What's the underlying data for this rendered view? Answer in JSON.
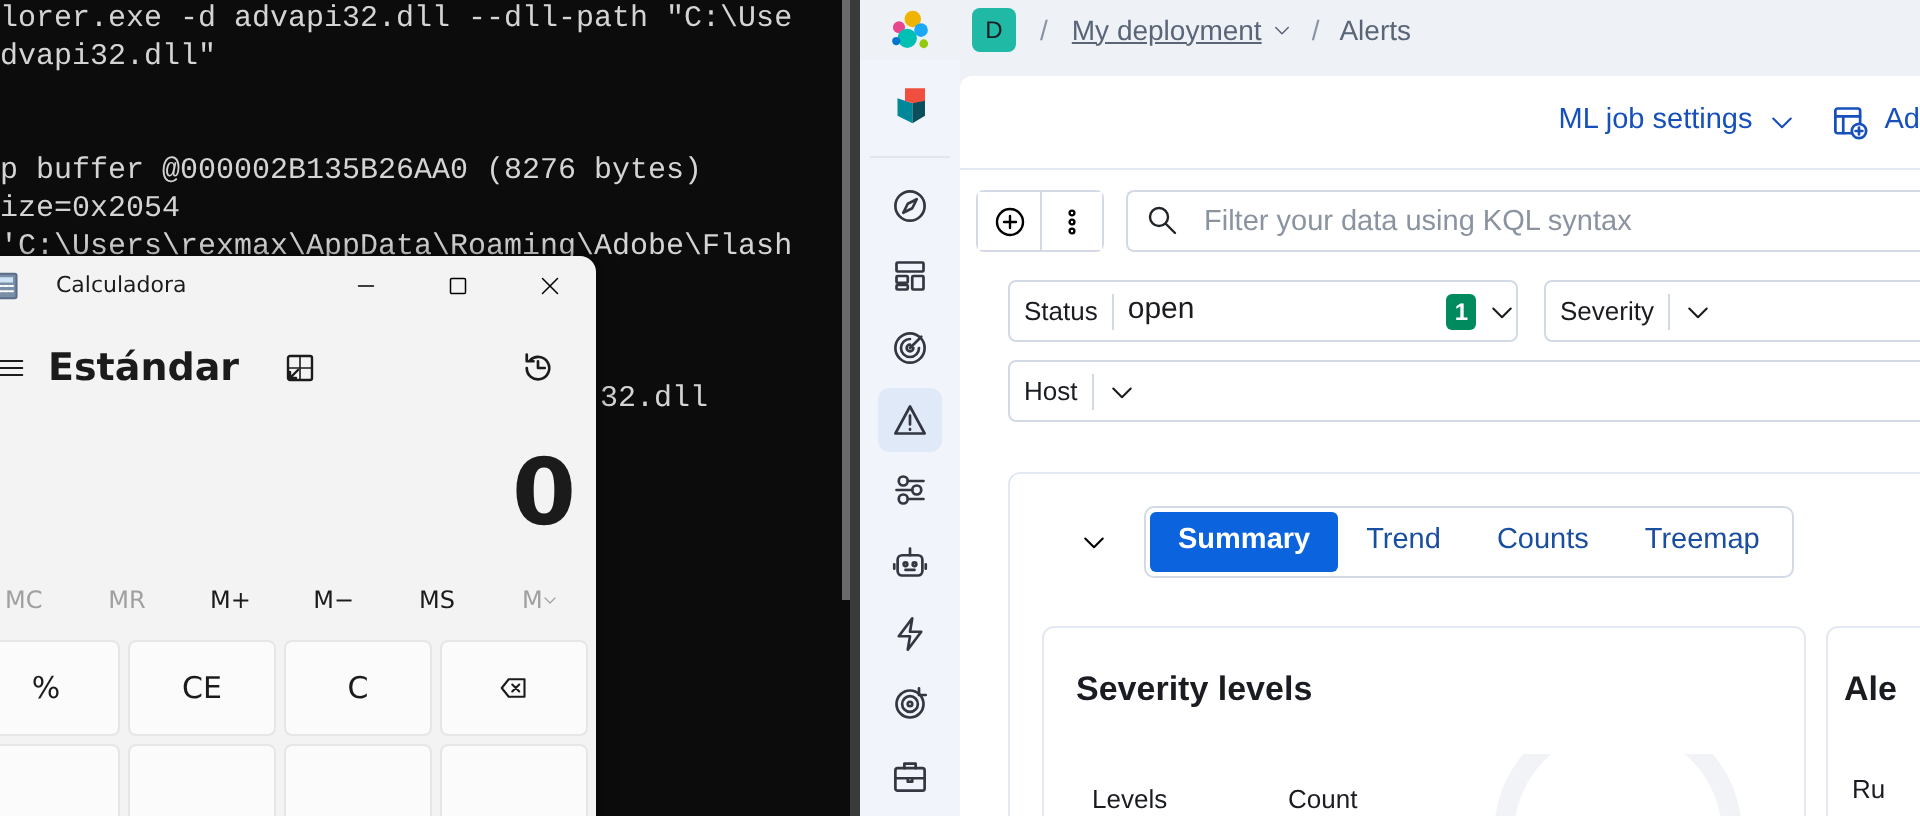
{
  "terminal": {
    "output_top": [
      "lorer.exe -d advapi32.dll --dll-path \"C:\\Use",
      "dvapi32.dll\""
    ],
    "output_middle": [
      "p buffer @000002B135B26AA0 (8276 bytes)",
      "ize=0x2054",
      "'C:\\Users\\rexmax\\AppData\\Roaming\\Adobe\\Flash"
    ],
    "output_beside_calculator": [
      "32.dll"
    ]
  },
  "calculator": {
    "title": "Calculadora",
    "mode": "Estándar",
    "display": "0",
    "memory": [
      {
        "kind": "text",
        "label": "MC",
        "disabled": true
      },
      {
        "kind": "text",
        "label": "MR",
        "disabled": true
      },
      {
        "kind": "text",
        "label": "M+",
        "disabled": false
      },
      {
        "kind": "text",
        "label": "M−",
        "disabled": false
      },
      {
        "kind": "text",
        "label": "MS",
        "disabled": false
      },
      {
        "kind": "dropdown",
        "label": "M",
        "disabled": true
      }
    ],
    "keys": [
      {
        "kind": "text",
        "label": "%"
      },
      {
        "kind": "text",
        "label": "CE"
      },
      {
        "kind": "text",
        "label": "C"
      },
      {
        "kind": "backspace"
      },
      {
        "kind": "blank"
      },
      {
        "kind": "blank"
      },
      {
        "kind": "blank"
      },
      {
        "kind": "blank"
      }
    ]
  },
  "kibana": {
    "breadcrumbs": {
      "avatar": "D",
      "separators": [
        "/",
        "/"
      ],
      "deployment": "My deployment",
      "page": "Alerts"
    },
    "sidebar": [
      {
        "kind": "compass",
        "selected": false
      },
      {
        "kind": "dashboard",
        "selected": false
      },
      {
        "kind": "radar",
        "selected": false
      },
      {
        "kind": "alert",
        "selected": true
      },
      {
        "kind": "sliders",
        "selected": false
      },
      {
        "kind": "robot",
        "selected": false
      },
      {
        "kind": "bolt",
        "selected": false
      },
      {
        "kind": "target",
        "selected": false
      },
      {
        "kind": "briefcase",
        "selected": false
      }
    ],
    "header_actions": [
      {
        "kind": "dropdown",
        "label": "ML job settings"
      },
      {
        "kind": "add",
        "label": "Ad"
      }
    ],
    "query": {
      "placeholder": "Filter your data using KQL syntax"
    },
    "filters": [
      {
        "label": "Status",
        "value": "open",
        "count": "1"
      },
      {
        "label": "Severity"
      },
      {
        "label": "Host"
      }
    ],
    "view_tabs": [
      {
        "label": "Summary",
        "selected": true
      },
      {
        "label": "Trend",
        "selected": false
      },
      {
        "label": "Counts",
        "selected": false
      },
      {
        "label": "Treemap",
        "selected": false
      }
    ],
    "severity_card": {
      "title": "Severity levels",
      "columns": [
        "Levels",
        "Count"
      ]
    },
    "second_card": {
      "title": "Ale",
      "column_1": "Ru"
    }
  }
}
